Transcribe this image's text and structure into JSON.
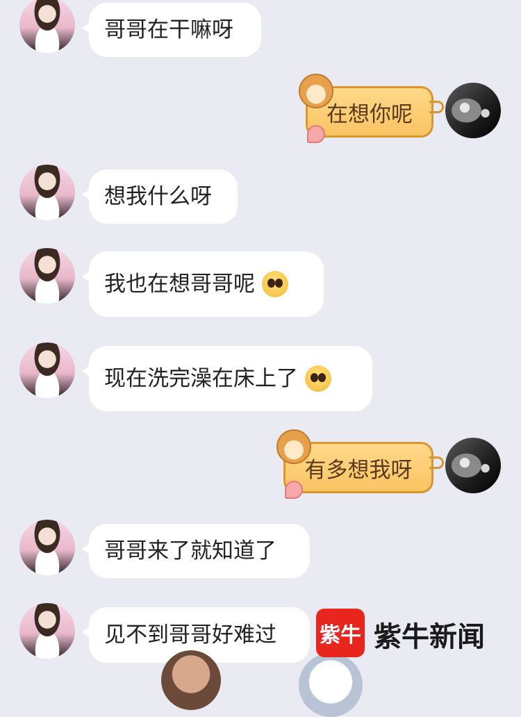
{
  "messages": [
    {
      "side": "in",
      "text": "哥哥在干嘛呀"
    },
    {
      "side": "out",
      "text": "在想你呢"
    },
    {
      "side": "in",
      "text": "想我什么呀"
    },
    {
      "side": "in",
      "text": "我也在想哥哥呢",
      "emoji": "pleading-face-emoji"
    },
    {
      "side": "in",
      "text": "现在洗完澡在床上了",
      "emoji": "pleading-face-emoji"
    },
    {
      "side": "out",
      "text": "有多想我呀"
    },
    {
      "side": "in",
      "text": "哥哥来了就知道了"
    },
    {
      "side": "in",
      "text": "见不到哥哥好难过"
    }
  ],
  "watermark": {
    "logo_char": "紫牛",
    "brand_text": "紫牛新闻"
  },
  "colors": {
    "background": "#e9eaf2",
    "incoming_bubble": "#ffffff",
    "outgoing_bubble": "#f9c463",
    "logo_red": "#e8261d"
  }
}
